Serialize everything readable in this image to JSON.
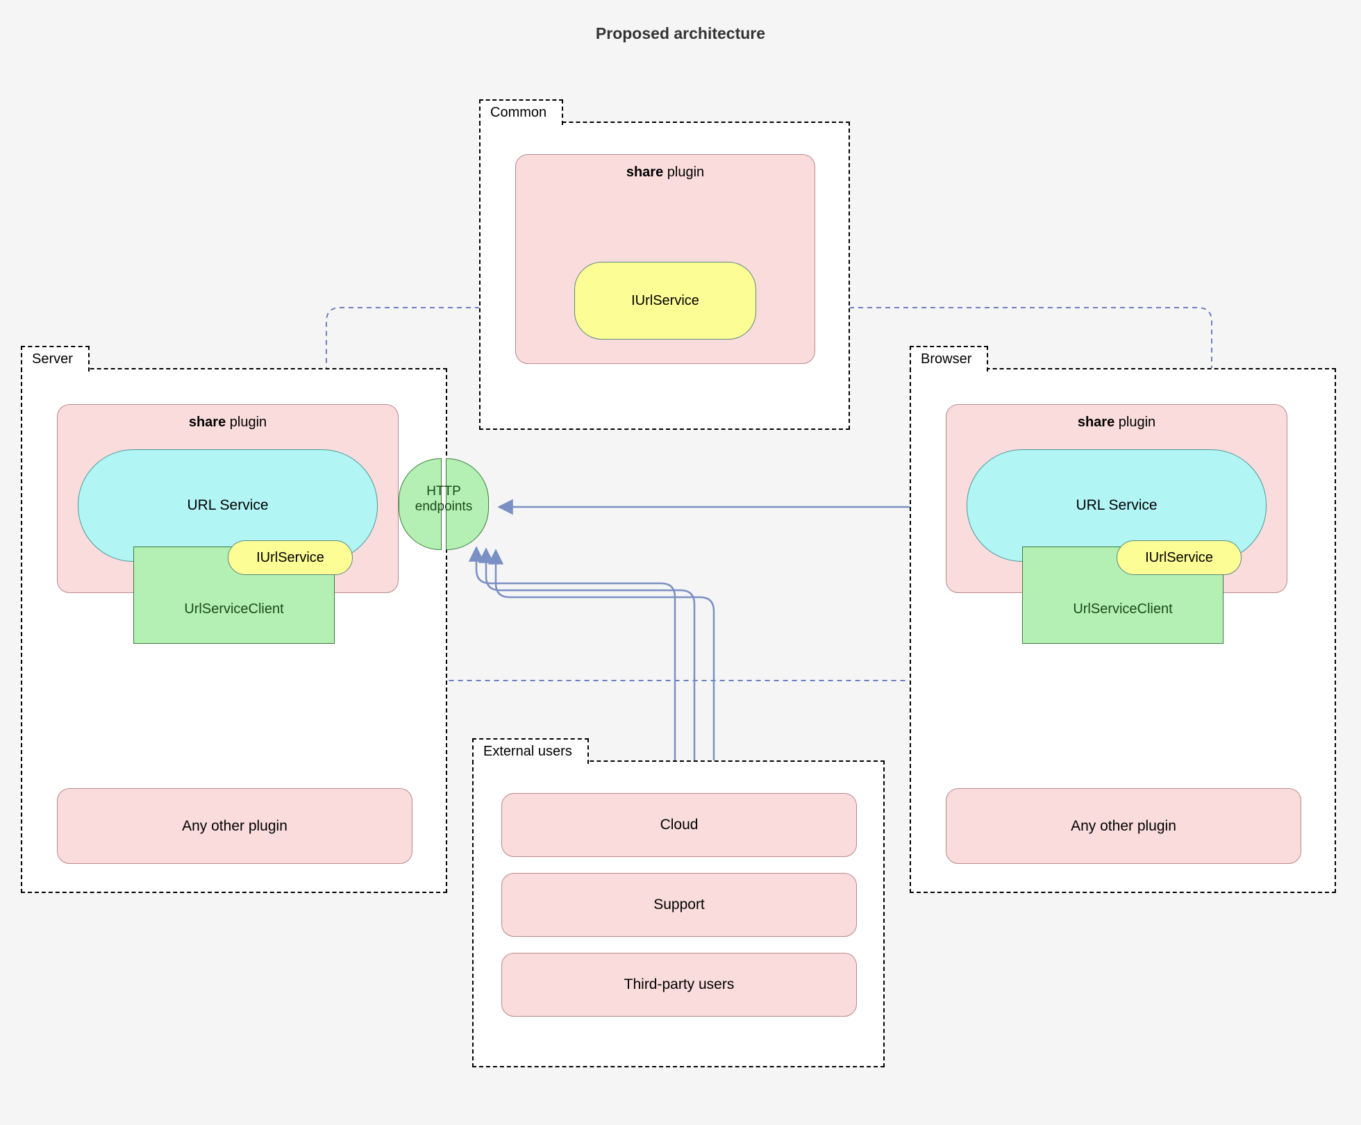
{
  "title": "Proposed architecture",
  "groups": {
    "common": "Common",
    "server": "Server",
    "browser": "Browser",
    "external": "External users"
  },
  "share_plugin": {
    "bold": "share",
    "rest": " plugin"
  },
  "iurlservice": "IUrlService",
  "url_service": "URL Service",
  "url_service_client": "UrlServiceClient",
  "any_other_plugin": "Any other plugin",
  "http_endpoints": {
    "line1": "HTTP",
    "line2": "endpoints"
  },
  "external_users": {
    "cloud": "Cloud",
    "support": "Support",
    "third_party": "Third-party users"
  },
  "colors": {
    "pink": "#fadcdc",
    "cyan": "#b2f5f5",
    "yellow": "#fdfd96",
    "green": "#b4f0b4",
    "arrow": "#7a8fc4"
  }
}
